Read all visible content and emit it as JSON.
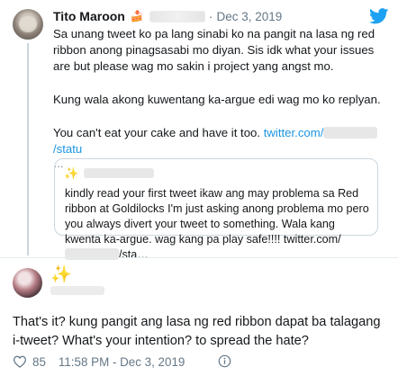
{
  "tweet": {
    "author_name": "Tito Maroon",
    "author_emoji": "🍰",
    "date": "Dec 3, 2019",
    "separator": "·",
    "line1": "Sa unang tweet ko pa lang sinabi ko na pangit na lasa ng red ribbon anong pinagsasabi mo diyan. Sis idk what your issues are but please wag mo sakin i project yang angst mo.",
    "line2": "Kung wala akong kuwentang ka-argue edi wag mo ko replyan.",
    "line3_text": "You can't eat your cake and have it too. ",
    "link_prefix": "twitter.com/",
    "link_suffix": "/statu",
    "ellipsis": "…"
  },
  "quoted_tweet": {
    "text": "kindly read your first tweet ikaw ang may problema sa Red ribbon at Goldilocks I'm just asking anong problema mo pero you always divert your tweet to something. Wala kang kwenta ka-argue. wag kang pa play safe!!!! twitter.com/",
    "suffix": "/sta…"
  },
  "reply": {
    "text": "That's it? kung pangit ang lasa ng red ribbon dapat ba talagang i-tweet? What's your intention? to spread the hate?",
    "likes": "85",
    "timestamp": "11:58 PM - Dec 3, 2019"
  },
  "colors": {
    "link": "#1b95e0",
    "muted": "#657786",
    "twitter_blue": "#1da1f2",
    "sparkle": "#f5b700"
  },
  "icons": [
    "twitter-bird-icon",
    "sparkle-icon",
    "heart-icon",
    "info-icon"
  ]
}
